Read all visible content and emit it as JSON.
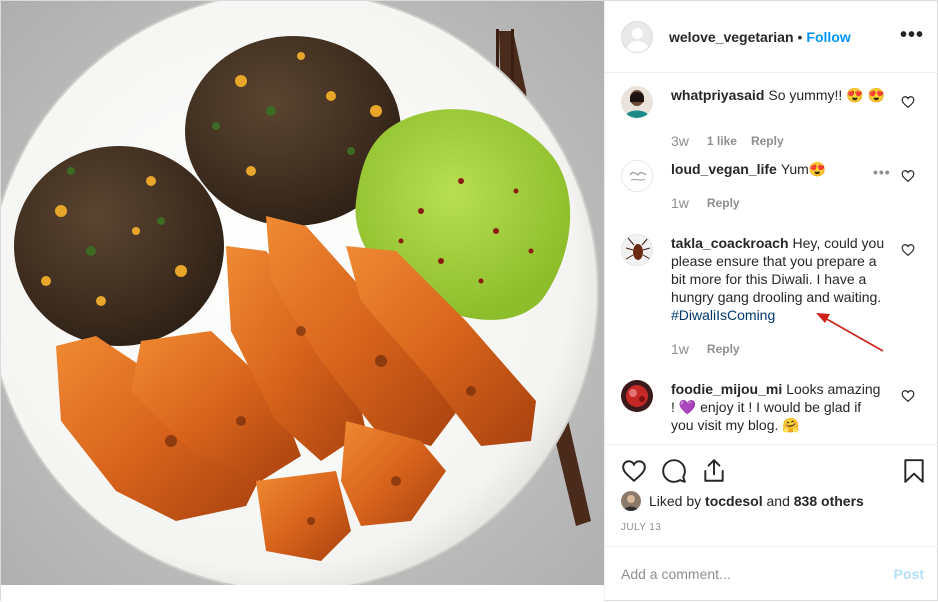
{
  "post": {
    "username": "welove_vegetarian",
    "dot": "•",
    "follow_label": "Follow",
    "more_icon": "more-horizontal-icon",
    "image_alt": "Plate with veggie burger patties, roasted sweet potato wedges and guacamole"
  },
  "comments": [
    {
      "username": "whatpriyasaid",
      "text": "So yummy!! 😍 😍",
      "time": "3w",
      "likes": "1 like",
      "reply": "Reply"
    },
    {
      "username": "loud_vegan_life",
      "text": "Yum😍",
      "time": "1w",
      "reply": "Reply",
      "more": "•••"
    },
    {
      "username": "takla_coackroach",
      "text": "Hey, could you please ensure that you prepare a bit more for this Diwali. I have a hungry gang drooling and waiting.",
      "hashtag": "#DiwaliIsComing",
      "time": "1w",
      "reply": "Reply"
    },
    {
      "username": "foodie_mijou_mi",
      "text": "Looks amazing ! 💜 enjoy it ! I would be glad if you visit my blog. 🤗"
    }
  ],
  "actions": {
    "like_icon": "heart-icon",
    "comment_icon": "comment-icon",
    "share_icon": "share-icon",
    "save_icon": "bookmark-icon"
  },
  "liked_by": {
    "prefix": "Liked by",
    "user": "tocdesol",
    "and": "and",
    "others": "838 others"
  },
  "date": "JULY 13",
  "add_comment": {
    "placeholder": "Add a comment...",
    "post_label": "Post"
  },
  "colors": {
    "link_blue": "#0095f6",
    "hashtag": "#00376b",
    "muted": "#8e8e8e",
    "post_disabled": "#b2dffc",
    "annotation_arrow": "#d0201a"
  }
}
